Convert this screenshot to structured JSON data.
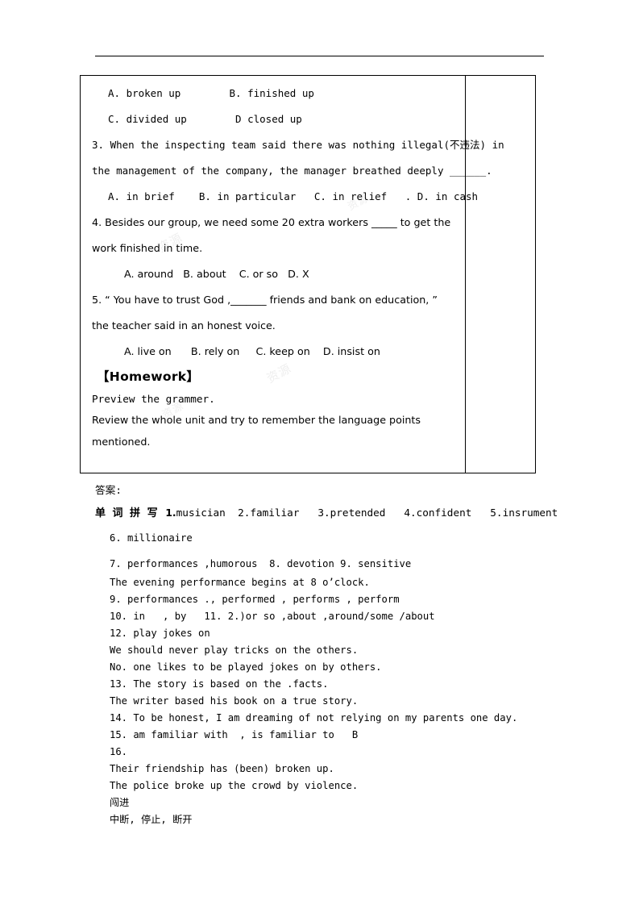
{
  "document": {
    "exercise_lines": [
      {
        "id": "q2-opts-a",
        "text": "A. broken up        B. finished up",
        "style": "mono",
        "indent": 1
      },
      {
        "id": "q2-opts-b",
        "text": "C. divided up        D closed up",
        "style": "mono",
        "indent": 1
      },
      {
        "id": "q3-stem-1",
        "text": "3. When the inspecting team said there was nothing illegal(不违法) in",
        "style": "mono",
        "indent": 0
      },
      {
        "id": "q3-stem-2",
        "text": "the management of the company, the manager breathed deeply ______.",
        "style": "mono",
        "indent": 0
      },
      {
        "id": "q3-opts",
        "text": "A. in brief    B. in particular   C. in relief   . D. in cash",
        "style": "mono",
        "indent": 1
      },
      {
        "id": "q4-stem-1",
        "text": "4. Besides our group, we need some 20 extra workers _____ to get the",
        "style": "sans",
        "indent": 0
      },
      {
        "id": "q4-stem-2",
        "text": "work finished in time.",
        "style": "sans",
        "indent": 0
      },
      {
        "id": "q4-opts",
        "text": "A. around   B. about    C. or so   D. X",
        "style": "sans",
        "indent": 2
      },
      {
        "id": "q5-stem-1",
        "text": "5. “ You have to trust God ,_______ friends and bank on education, ”",
        "style": "sans",
        "indent": 0
      },
      {
        "id": "q5-stem-2",
        "text": "the teacher said in an honest voice.",
        "style": "sans",
        "indent": 0
      },
      {
        "id": "q5-opts",
        "text": "A. live on      B. rely on     C. keep on    D. insist on",
        "style": "sans",
        "indent": 2
      }
    ],
    "homework": {
      "title": "【Homework】",
      "lines": [
        {
          "id": "hw-1",
          "text": "Preview the grammer.",
          "style": "mono"
        },
        {
          "id": "hw-2",
          "text": "Review the whole unit and try to remember the language points",
          "style": "sans"
        },
        {
          "id": "hw-3",
          "text": "mentioned.",
          "style": "sans"
        }
      ]
    },
    "answers": {
      "heading": "答案:",
      "spelling": {
        "label": "单 词 拼 写",
        "items": [
          {
            "num": "1.",
            "word": "musician"
          },
          {
            "num": "2.",
            "word": "familiar"
          },
          {
            "num": "3.",
            "word": "pretended"
          },
          {
            "num": "4.",
            "word": "confident"
          },
          {
            "num": "5.",
            "word": "insrument"
          }
        ]
      },
      "lines": [
        {
          "id": "a-6",
          "text": "6. millionaire"
        },
        {
          "id": "a-7",
          "text": "7. performances ,humorous  8. devotion 9. sensitive"
        },
        {
          "id": "a-7b",
          "text": "The evening performance begins at 8 o’clock."
        },
        {
          "id": "a-9",
          "text": "9. performances ., performed , performs , perform"
        },
        {
          "id": "a-10",
          "text": "10. in   , by   11. 2.)or so ,about ,around/some /about"
        },
        {
          "id": "a-12",
          "text": "12. play jokes on"
        },
        {
          "id": "a-12b",
          "text": "We should never play tricks on the others."
        },
        {
          "id": "a-12c",
          "text": "No. one likes to be played jokes on by others."
        },
        {
          "id": "a-13",
          "text": "13. The story is based on the .facts."
        },
        {
          "id": "a-13b",
          "text": "The writer based his book on a true story."
        },
        {
          "id": "a-14",
          "text": "14. To be honest, I am dreaming of not relying on my parents one day."
        },
        {
          "id": "a-15",
          "text": "15. am familiar with  , is familiar to   B"
        },
        {
          "id": "a-16",
          "text": "16."
        },
        {
          "id": "a-16b",
          "text": "Their friendship has (been) broken up."
        },
        {
          "id": "a-16c",
          "text": "The police broke up the crowd by violence."
        },
        {
          "id": "a-16d",
          "text": "闯进"
        },
        {
          "id": "a-16e",
          "text": "中断, 停止, 断开"
        }
      ]
    },
    "watermarks": [
      {
        "id": "wm-1",
        "text": "资源"
      },
      {
        "id": "wm-2",
        "text": "资源"
      },
      {
        "id": "wm-3",
        "text": "资源"
      },
      {
        "id": "wm-4",
        "text": "资源"
      }
    ]
  }
}
